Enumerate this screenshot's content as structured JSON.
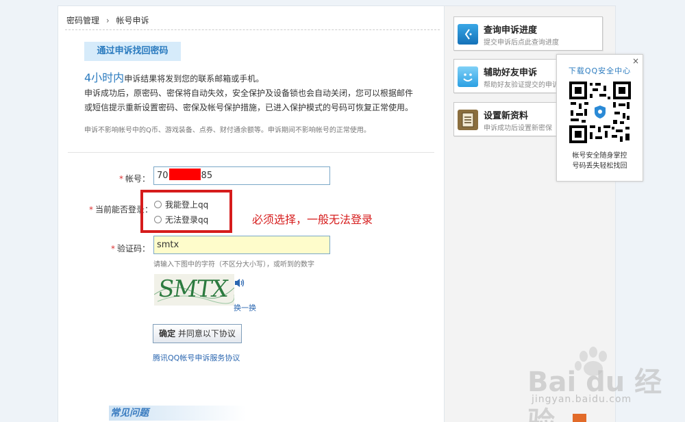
{
  "breadcrumb": {
    "parent": "密码管理",
    "separator": "›",
    "current": "帐号申诉"
  },
  "banner": "通过申诉找回密码",
  "info": {
    "hours": "4小时内",
    "line1_rest": "申诉结果将发到您的联系邮箱或手机。",
    "line2": "申诉成功后，原密码、密保将自动失效，安全保护及设备锁也会自动关闭，您可以根据邮件",
    "line3": "或短信提示重新设置密码、密保及帐号保护措施，已进入保护模式的号码可恢复正常使用。",
    "note": "申诉不影响帐号中的Q币、游戏装备、点券、财付通余额等。申诉期间不影响帐号的正常使用。"
  },
  "form": {
    "required_mark": "*",
    "account_label": "帐号：",
    "account_prefix": "70",
    "account_suffix": "85",
    "login_label": "当前能否登录：",
    "option_can": "我能登上qq",
    "option_cannot": "无法登录qq",
    "captcha_label": "验证码：",
    "captcha_value": "smtx",
    "captcha_hint": "请输入下图中的字符（不区分大小写），或听到的数字",
    "captcha_image_text": "SMTX",
    "refresh": "换一换",
    "confirm_bold": "确定",
    "confirm_rest": "并同意以下协议",
    "agreement_link": "腾讯QQ帐号申诉服务协议"
  },
  "annotation": "必须选择，一般无法登录",
  "faq_title": "常见问题",
  "sidebar": {
    "cards": [
      {
        "title": "查询申诉进度",
        "sub": "提交申诉后点此查询进度",
        "icon": "clock-icon"
      },
      {
        "title": "辅助好友申诉",
        "sub": "帮助好友验证提交的申诉",
        "icon": "smile-icon"
      },
      {
        "title": "设置新资料",
        "sub": "申诉成功后设置新密保",
        "icon": "document-icon"
      }
    ]
  },
  "qr_panel": {
    "title": "下载QQ安全中心",
    "close": "×",
    "line1": "帐号安全随身掌控",
    "line2": "号码丢失轻松找回"
  },
  "watermark": {
    "logo": "Bai du 经验",
    "url": "jingyan.baidu.com"
  },
  "colors": {
    "accent": "#2b7bbf",
    "alert": "#d61c1c",
    "required": "#d33333"
  }
}
